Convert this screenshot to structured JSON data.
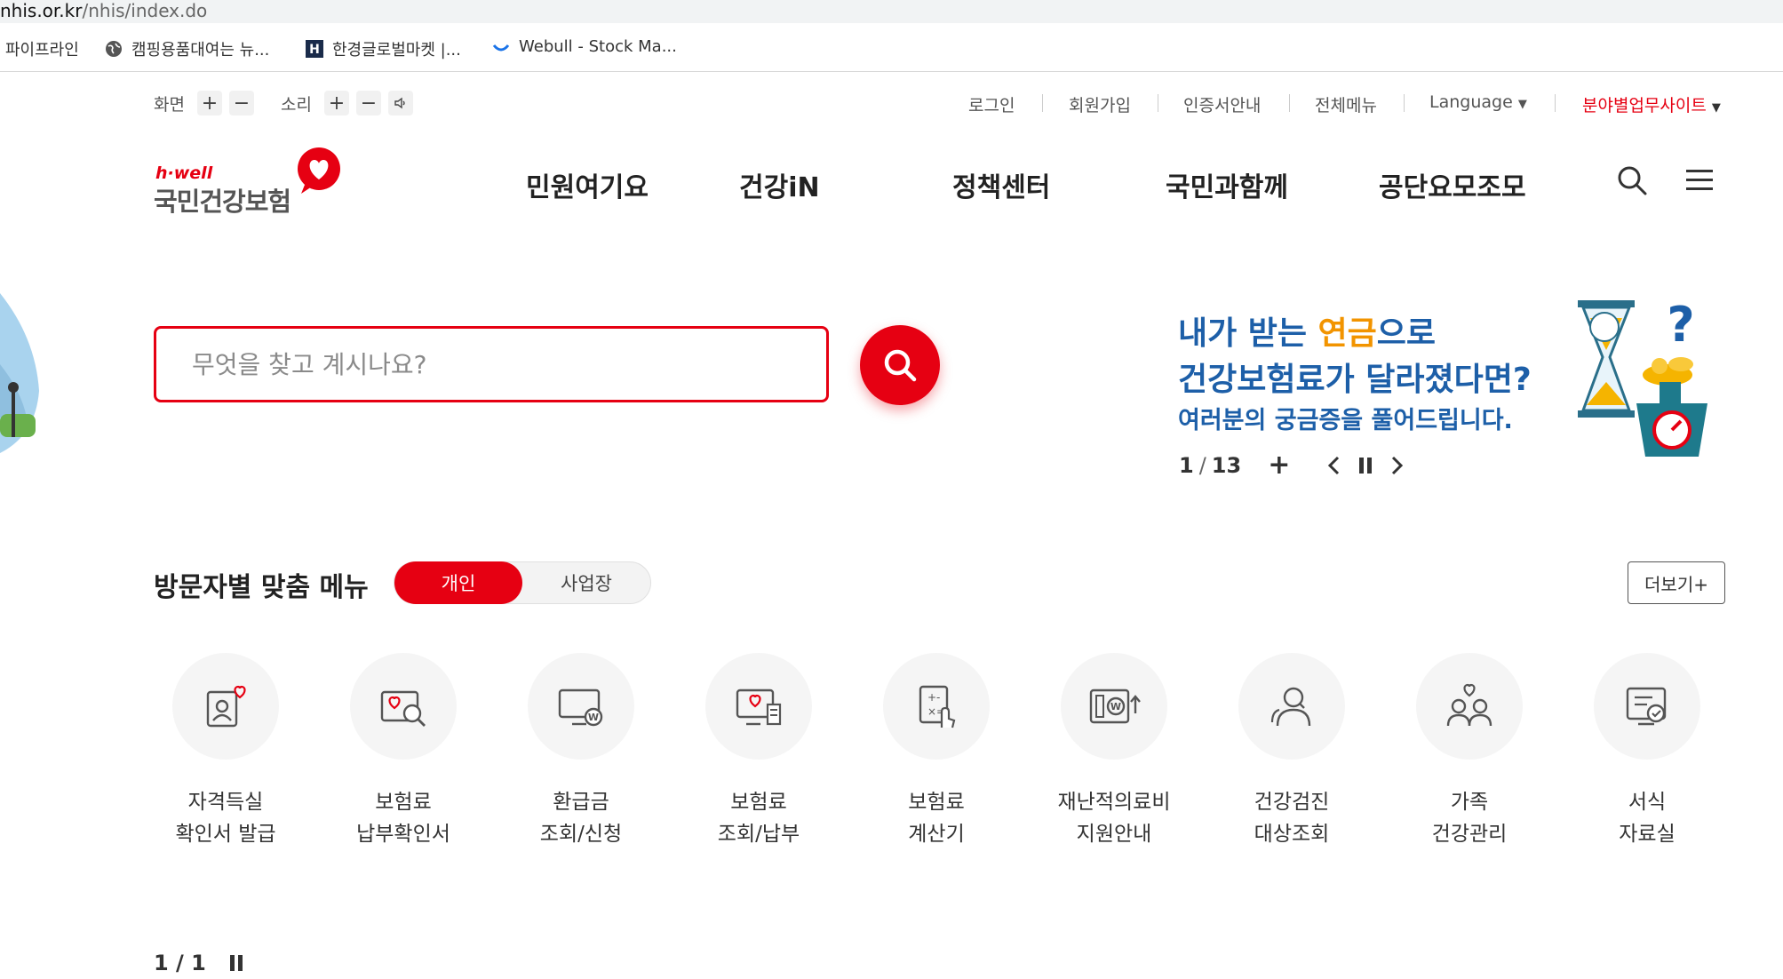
{
  "browser": {
    "url_domain": "nhis.or.kr",
    "url_path": "/nhis/index.do",
    "bookmarks": [
      {
        "label": "파이프라인",
        "icon": "none"
      },
      {
        "label": "캠핑용품대여는 뉴...",
        "icon": "globe-icon"
      },
      {
        "label": "한경글로벌마켓 |...",
        "icon": "h-logo-icon"
      },
      {
        "label": "Webull - Stock Ma...",
        "icon": "webull-icon"
      }
    ]
  },
  "util": {
    "screen_label": "화면",
    "sound_label": "소리",
    "plus": "+",
    "minus": "−",
    "links": {
      "login": "로그인",
      "signup": "회원가입",
      "certificate": "인증서안내",
      "all_menu": "전체메뉴",
      "language": "Language",
      "field_site": "분야별업무사이트"
    }
  },
  "logo": {
    "small": "h·well",
    "main": "국민건강보험"
  },
  "nav": {
    "items": [
      "민원여기요",
      "건강iN",
      "정책센터",
      "국민과함께",
      "공단요모조모"
    ]
  },
  "search": {
    "placeholder": "무엇을 찾고 계시나요?"
  },
  "banner": {
    "line1_pre": "내가 받는 ",
    "line1_highlight": "연금",
    "line1_post": "으로",
    "line2": "건강보험료가 달라졌다면?",
    "line3": "여러분의 궁금증을 풀어드립니다.",
    "current": "1",
    "separator": "/",
    "total": "13",
    "plus": "+"
  },
  "visitor_menu": {
    "title": "방문자별 맞춤 메뉴",
    "tab_personal": "개인",
    "tab_business": "사업장",
    "more": "더보기+",
    "items": [
      {
        "line1": "자격득실",
        "line2": "확인서 발급",
        "icon": "id-card-heart-icon"
      },
      {
        "line1": "보험료",
        "line2": "납부확인서",
        "icon": "document-search-icon"
      },
      {
        "line1": "환급금",
        "line2": "조회/신청",
        "icon": "monitor-won-icon"
      },
      {
        "line1": "보험료",
        "line2": "조회/납부",
        "icon": "monitor-receipt-icon"
      },
      {
        "line1": "보험료",
        "line2": "계산기",
        "icon": "calculator-hand-icon"
      },
      {
        "line1": "재난적의료비",
        "line2": "지원안내",
        "icon": "money-up-icon"
      },
      {
        "line1": "건강검진",
        "line2": "대상조회",
        "icon": "people-search-icon"
      },
      {
        "line1": "가족",
        "line2": "건강관리",
        "icon": "family-heart-icon"
      },
      {
        "line1": "서식",
        "line2": "자료실",
        "icon": "form-check-icon"
      }
    ],
    "pager": "1 / 1"
  },
  "colors": {
    "brand_red": "#e60012",
    "banner_blue": "#1d5fa8",
    "banner_orange": "#f29400"
  }
}
